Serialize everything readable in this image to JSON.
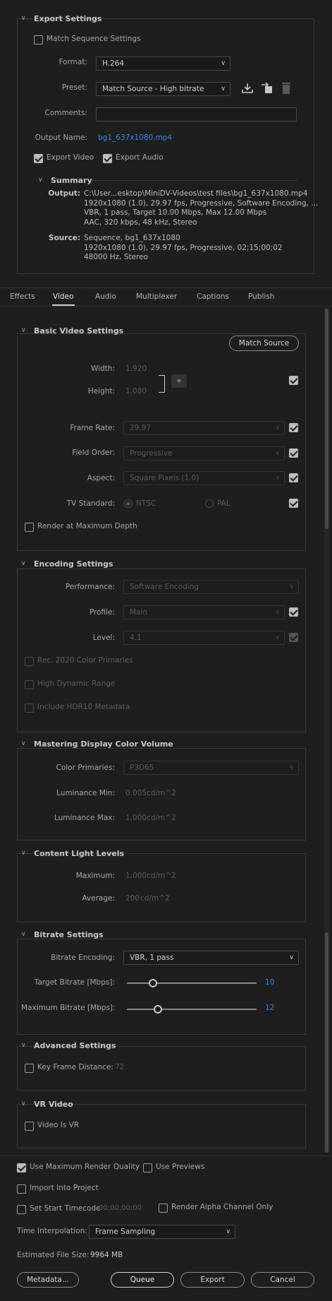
{
  "export_settings": {
    "header": "Export Settings",
    "match_sequence": {
      "label": "Match Sequence Settings",
      "checked": false
    },
    "format": {
      "label": "Format:",
      "value": "H.264"
    },
    "preset": {
      "label": "Preset:",
      "value": "Match Source - High bitrate"
    },
    "comments": {
      "label": "Comments:",
      "value": ""
    },
    "output_name": {
      "label": "Output Name:",
      "value": "bg1_637x1080.mp4"
    },
    "export_video": {
      "label": "Export Video",
      "checked": true
    },
    "export_audio": {
      "label": "Export Audio",
      "checked": true
    },
    "summary": {
      "header": "Summary",
      "output_label": "Output:",
      "output_lines": [
        "C:\\User...esktop\\MiniDV-Videos\\test files\\bg1_637x1080.mp4",
        "1920x1080 (1.0), 29.97 fps, Progressive, Software Encoding, ...",
        "VBR, 1 pass, Target 10.00 Mbps, Max 12.00 Mbps",
        "AAC, 320 kbps, 48 kHz, Stereo"
      ],
      "source_label": "Source:",
      "source_lines": [
        "Sequence, bg1_637x1080",
        "1920x1080 (1.0), 29.97 fps, Progressive, 02;15;00;02",
        "48000 Hz, Stereo"
      ]
    }
  },
  "tabs": [
    "Effects",
    "Video",
    "Audio",
    "Multiplexer",
    "Captions",
    "Publish"
  ],
  "active_tab": "Video",
  "basic_video": {
    "header": "Basic Video Settings",
    "match_source": "Match Source",
    "width": {
      "label": "Width:",
      "value": "1,920"
    },
    "height": {
      "label": "Height:",
      "value": "1,080"
    },
    "frame_rate": {
      "label": "Frame Rate:",
      "value": "29.97"
    },
    "field_order": {
      "label": "Field Order:",
      "value": "Progressive"
    },
    "aspect": {
      "label": "Aspect:",
      "value": "Square Pixels (1.0)"
    },
    "tv_standard": {
      "label": "TV Standard:",
      "ntsc": "NTSC",
      "pal": "PAL"
    },
    "render_max_depth": "Render at Maximum Depth"
  },
  "encoding": {
    "header": "Encoding Settings",
    "performance": {
      "label": "Performance:",
      "value": "Software Encoding"
    },
    "profile": {
      "label": "Profile:",
      "value": "Main"
    },
    "level": {
      "label": "Level:",
      "value": "4.1"
    },
    "rec2020": "Rec. 2020 Color Primaries",
    "hdr": "High Dynamic Range",
    "hdr10": "Include HDR10 Metadata"
  },
  "mastering": {
    "header": "Mastering Display Color Volume",
    "color_primaries": {
      "label": "Color Primaries:",
      "value": "P3D65"
    },
    "lum_min": {
      "label": "Luminance Min:",
      "value": "0.005",
      "unit": "cd/m^2"
    },
    "lum_max": {
      "label": "Luminance Max:",
      "value": "1,000",
      "unit": "cd/m^2"
    }
  },
  "content_light": {
    "header": "Content Light Levels",
    "maximum": {
      "label": "Maximum:",
      "value": "1,000",
      "unit": "cd/m^2"
    },
    "average": {
      "label": "Average:",
      "value": "200",
      "unit": "cd/m^2"
    }
  },
  "bitrate": {
    "header": "Bitrate Settings",
    "encoding": {
      "label": "Bitrate Encoding:",
      "value": "VBR, 1 pass"
    },
    "target": {
      "label": "Target Bitrate [Mbps]:",
      "value": "10",
      "fraction": 0.2
    },
    "maximum": {
      "label": "Maximum Bitrate [Mbps]:",
      "value": "12",
      "fraction": 0.24
    }
  },
  "advanced": {
    "header": "Advanced Settings",
    "key_frame": {
      "label": "Key Frame Distance:",
      "value": "72"
    }
  },
  "vr": {
    "header": "VR Video",
    "video_is_vr": "Video Is VR"
  },
  "footer": {
    "use_max_render": "Use Maximum Render Quality",
    "use_previews": "Use Previews",
    "import_project": "Import Into Project",
    "set_start_tc": "Set Start Timecode",
    "start_tc_value": "00;00;00;00",
    "render_alpha": "Render Alpha Channel Only",
    "time_interp_label": "Time Interpolation:",
    "time_interp_value": "Frame Sampling",
    "est_size_label": "Estimated File Size:",
    "est_size_value": "9964 MB",
    "metadata_btn": "Metadata...",
    "queue_btn": "Queue",
    "export_btn": "Export",
    "cancel_btn": "Cancel"
  }
}
